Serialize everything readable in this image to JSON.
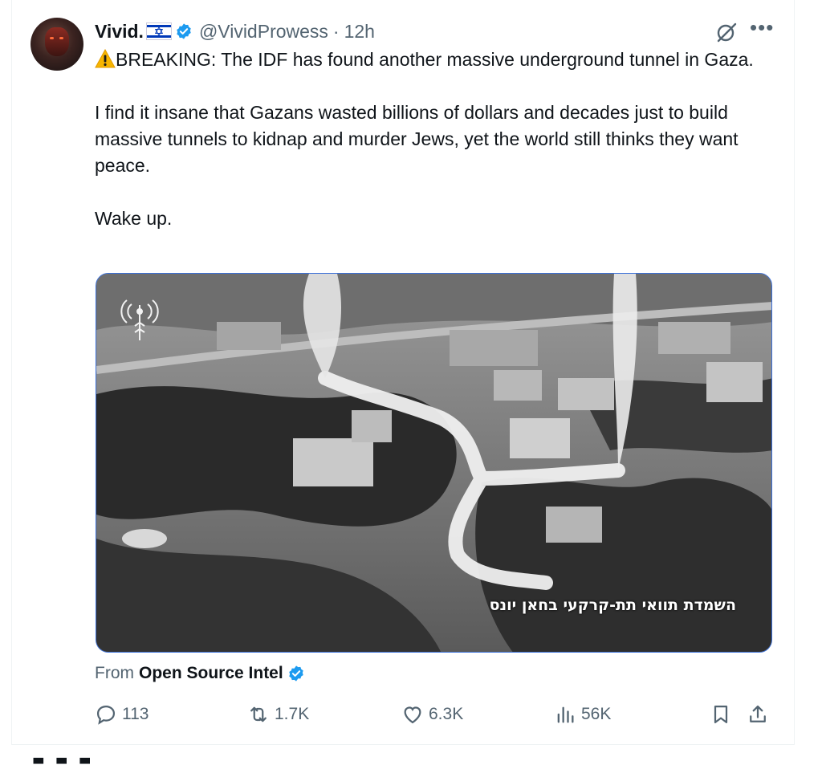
{
  "tweet": {
    "author": {
      "display_name": "Vivid.",
      "flag": "israel-flag",
      "verified": true,
      "handle": "@VividProwess",
      "separator": "·",
      "time": "12h"
    },
    "text": {
      "line1": "BREAKING: The IDF has found another massive underground tunnel in Gaza.",
      "line2": "I find it insane that Gazans wasted billions of dollars and decades just to build massive tunnels to kidnap and murder Jews, yet the world still thinks they want peace.",
      "line3": "Wake up."
    },
    "media": {
      "caption": "השמדת תוואי תת-קרקעי בחאן יונס",
      "icon": "idf-spokesperson-logo"
    },
    "attribution": {
      "label": "From",
      "source": "Open Source Intel",
      "verified": true
    },
    "actions": {
      "replies": "113",
      "reposts": "1.7K",
      "likes": "6.3K",
      "views": "56K"
    }
  },
  "colors": {
    "verified_blue": "#1d9bf0",
    "text_primary": "#0f1419",
    "text_secondary": "#536471",
    "media_border": "#3a6fd8"
  }
}
